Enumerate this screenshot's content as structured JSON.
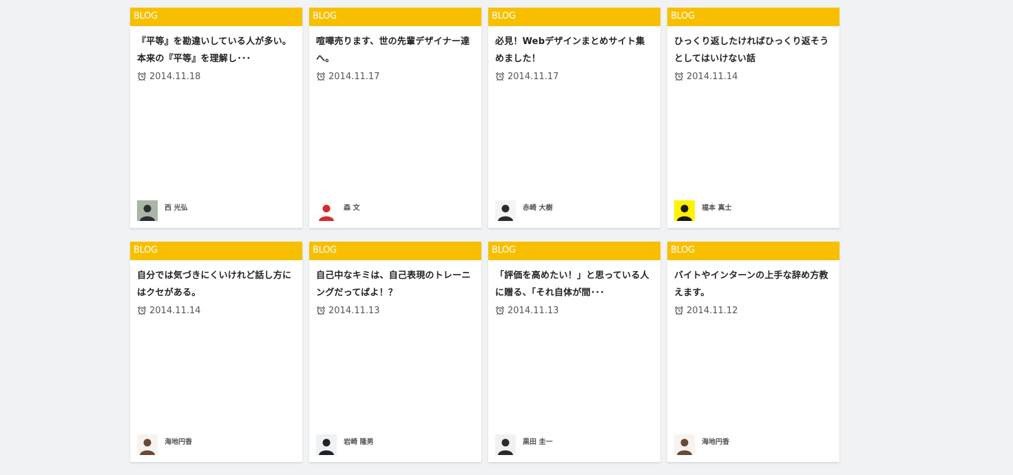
{
  "cards": [
    {
      "category": "BLOG",
      "title": "『平等』を勘違いしている人が多い。本来の『平等』を理解し･･･",
      "date": "2014.11.18",
      "author": "西 光弘",
      "avatar_bg": "#a9b6a4",
      "avatar_fg": "#2a2e35"
    },
    {
      "category": "BLOG",
      "title": "喧嘩売ります、世の先輩デザイナー達へ。",
      "date": "2014.11.17",
      "author": "森 文",
      "avatar_bg": "#ffffff",
      "avatar_fg": "#d9282a"
    },
    {
      "category": "BLOG",
      "title": "必見！Webデザインまとめサイト集めました！",
      "date": "2014.11.17",
      "author": "赤崎 大樹",
      "avatar_bg": "#f4f4f4",
      "avatar_fg": "#2b2b2b"
    },
    {
      "category": "BLOG",
      "title": "ひっくり返したければひっくり返そうとしてはいけない話",
      "date": "2014.11.14",
      "author": "福本 真士",
      "avatar_bg": "#fff200",
      "avatar_fg": "#1a1a1a"
    },
    {
      "category": "BLOG",
      "title": "自分では気づきにくいけれど話し方にはクセがある。",
      "date": "2014.11.14",
      "author": "海地円香",
      "avatar_bg": "#f7f3ef",
      "avatar_fg": "#6b4a33"
    },
    {
      "category": "BLOG",
      "title": "自己中なキミは、自己表現のトレーニングだってばよ！？",
      "date": "2014.11.13",
      "author": "岩崎 隆男",
      "avatar_bg": "#eef2f5",
      "avatar_fg": "#1f2326"
    },
    {
      "category": "BLOG",
      "title": "「評価を高めたい！」と思っている人に贈る、「それ自体が間･･･",
      "date": "2014.11.13",
      "author": "黒田 圭一",
      "avatar_bg": "#f1f1f1",
      "avatar_fg": "#2a2a2a"
    },
    {
      "category": "BLOG",
      "title": "バイトやインターンの上手な辞め方教えます。",
      "date": "2014.11.12",
      "author": "海地円香",
      "avatar_bg": "#f7f3ef",
      "avatar_fg": "#6b4a33"
    }
  ],
  "colors": {
    "category_bg": "#f8bf00",
    "page_bg": "#f0f2f3"
  },
  "icons": {
    "date": "alarm-clock-icon",
    "author": "author-avatar"
  }
}
